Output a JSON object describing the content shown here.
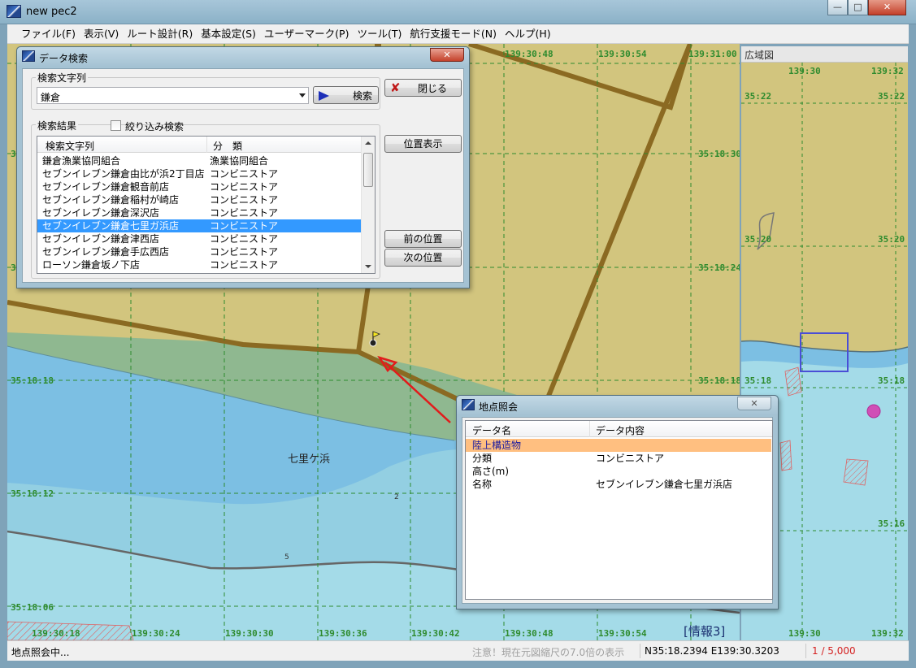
{
  "window": {
    "title": "new pec2"
  },
  "menu": [
    "ファイル(F)",
    "表示(V)",
    "ルート設計(R)",
    "基本設定(S)",
    "ユーザーマーク(P)",
    "ツール(T)",
    "航行支援モード(N)",
    "ヘルプ(H)"
  ],
  "map": {
    "top_labels": [
      "139:30:48",
      "139:30:54",
      "139:31:00"
    ],
    "bottom_labels": [
      "139:30:18",
      "139:30:24",
      "139:30:30",
      "139:30:36",
      "139:30:42",
      "139:30:48",
      "139:30:54"
    ],
    "right_lat_labels": [
      "35:18:30",
      "35:18:24",
      "35:18:18"
    ],
    "left_lat_labels": [
      "35:18:18",
      "35:18:12",
      "35:18:06"
    ],
    "left_partial_labels": [
      "3",
      "3"
    ],
    "place_name": "七里ケ浜",
    "depth_2": "2",
    "depth_5": "5",
    "info_badge": "[情報3]",
    "colors": {
      "land": "#d2c57e",
      "road": "#8b6a22",
      "shallow": "#7cbfe3",
      "medium": "#a4dbe8",
      "beach": "#8fb890",
      "grid": "#2e8b2e",
      "arrow": "#e21b1b"
    }
  },
  "overview": {
    "title": "広域図",
    "top_labels": [
      "139:30",
      "139:32"
    ],
    "bottom_labels": [
      "139:30",
      "139:32"
    ],
    "left_labels": [
      "35:22",
      "35:20",
      "35:18"
    ],
    "right_labels": [
      "35:22",
      "35:20",
      "35:18",
      "35:16"
    ]
  },
  "search_dialog": {
    "title": "データ検索",
    "search_label": "検索文字列",
    "search_value": "鎌倉",
    "search_button": "検索",
    "close_button": "閉じる",
    "results_label": "検索結果",
    "filter_label": "絞り込み検索",
    "columns": [
      "検索文字列",
      "分　類"
    ],
    "rows": [
      [
        "鎌倉漁業協同組合",
        "漁業協同組合"
      ],
      [
        "セブンイレブン鎌倉由比が浜2丁目店",
        "コンビニストア"
      ],
      [
        "セブンイレブン鎌倉観音前店",
        "コンビニストア"
      ],
      [
        "セブンイレブン鎌倉稲村が崎店",
        "コンビニストア"
      ],
      [
        "セブンイレブン鎌倉深沢店",
        "コンビニストア"
      ],
      [
        "セブンイレブン鎌倉七里ガ浜店",
        "コンビニストア"
      ],
      [
        "セブンイレブン鎌倉津西店",
        "コンビニストア"
      ],
      [
        "セブンイレブン鎌倉手広西店",
        "コンビニストア"
      ],
      [
        "ローソン鎌倉坂ノ下店",
        "コンビニストア"
      ]
    ],
    "selected_index": 5,
    "position_button": "位置表示",
    "prev_button": "前の位置",
    "next_button": "次の位置"
  },
  "point_dialog": {
    "title": "地点照会",
    "columns": [
      "データ名",
      "データ内容"
    ],
    "rows": [
      [
        "陸上構造物",
        ""
      ],
      [
        "分類",
        "コンビニストア"
      ],
      [
        "高さ(m)",
        ""
      ],
      [
        "名称",
        "セブンイレブン鎌倉七里ガ浜店"
      ]
    ],
    "highlight_color": "#ffbf80"
  },
  "status": {
    "mode": "地点照会中...",
    "notice": "注意！現在元図縮尺の7.0倍の表示",
    "coords": "N35:18.2394 E139:30.3203",
    "scale": "1 / 5,000"
  }
}
